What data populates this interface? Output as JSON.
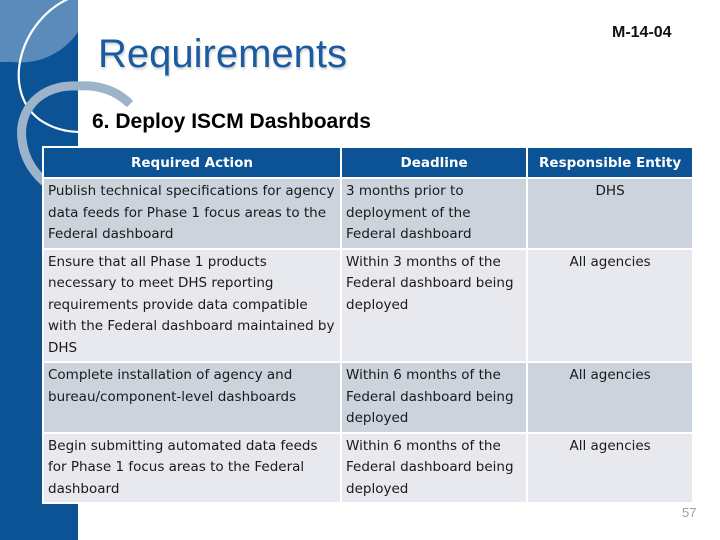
{
  "slide": {
    "doc_id": "M-14-04",
    "title": "Requirements",
    "subtitle": "6. Deploy ISCM Dashboards",
    "page_number": "57"
  },
  "table": {
    "headers": [
      "Required Action",
      "Deadline",
      "Responsible Entity"
    ],
    "rows": [
      {
        "action": "Publish technical specifications for agency data feeds for Phase 1 focus areas to the Federal dashboard",
        "deadline": "3 months prior to deployment of the Federal dashboard",
        "entity": "DHS"
      },
      {
        "action": "Ensure that all Phase 1 products necessary to meet DHS reporting requirements provide data compatible with the Federal dashboard maintained by DHS",
        "deadline": "Within 3 months of the Federal dashboard being deployed",
        "entity": "All agencies"
      },
      {
        "action": "Complete installation of agency and bureau/component-level dashboards",
        "deadline": "Within 6 months of the Federal dashboard being deployed",
        "entity": "All agencies"
      },
      {
        "action": "Begin submitting automated data feeds for Phase 1 focus areas to the Federal dashboard",
        "deadline": "Within 6 months of the Federal dashboard being deployed",
        "entity": "All agencies"
      }
    ]
  },
  "colors": {
    "brand_blue": "#0b5394",
    "title_blue": "#1a5ba0",
    "row_dark": "#cdd3dc",
    "row_light": "#e8e9ee"
  }
}
